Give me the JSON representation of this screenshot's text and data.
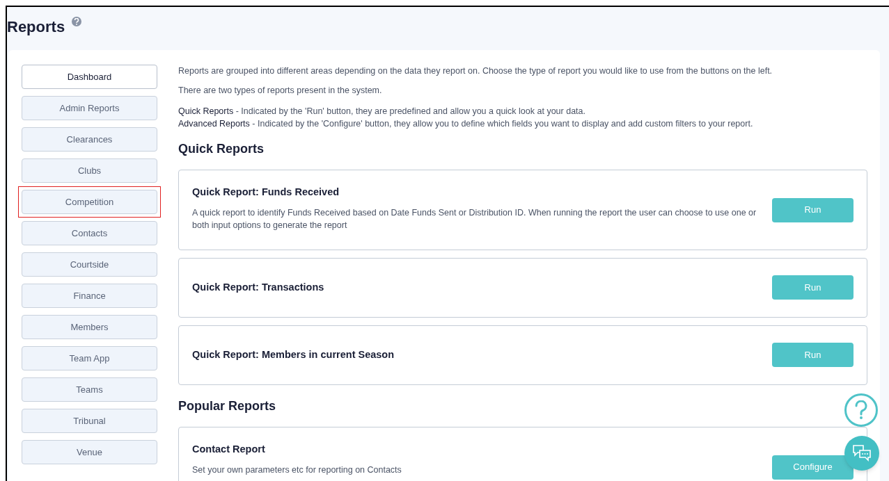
{
  "page_title": "Reports",
  "nav": [
    {
      "label": "Dashboard",
      "selected": true,
      "highlighted": false
    },
    {
      "label": "Admin Reports",
      "selected": false,
      "highlighted": false
    },
    {
      "label": "Clearances",
      "selected": false,
      "highlighted": false
    },
    {
      "label": "Clubs",
      "selected": false,
      "highlighted": false
    },
    {
      "label": "Competition",
      "selected": false,
      "highlighted": true
    },
    {
      "label": "Contacts",
      "selected": false,
      "highlighted": false
    },
    {
      "label": "Courtside",
      "selected": false,
      "highlighted": false
    },
    {
      "label": "Finance",
      "selected": false,
      "highlighted": false
    },
    {
      "label": "Members",
      "selected": false,
      "highlighted": false
    },
    {
      "label": "Team App",
      "selected": false,
      "highlighted": false
    },
    {
      "label": "Teams",
      "selected": false,
      "highlighted": false
    },
    {
      "label": "Tribunal",
      "selected": false,
      "highlighted": false
    },
    {
      "label": "Venue",
      "selected": false,
      "highlighted": false
    }
  ],
  "intro": [
    "Reports are grouped into different areas depending on the data they report on. Choose the type of report you would like to use from the buttons on the left.",
    "There are two types of reports present in the system."
  ],
  "legend": [
    "**Quick Reports** - Indicated by the 'Run' button, they are predefined and allow you a quick look at your data.",
    "**Advanced Reports** - Indicated by the 'Configure' button, they allow you to define which fields you want to display and add custom filters to your report."
  ],
  "sections": [
    {
      "title": "Quick Reports",
      "cards": [
        {
          "title": "Quick Report: Funds Received",
          "description": "A quick report to identify Funds Received based on Date Funds Sent or Distribution ID. When running the report the user can choose to use one or both input options to generate the report",
          "button": "Run"
        },
        {
          "title": "Quick Report: Transactions",
          "button": "Run"
        },
        {
          "title": "Quick Report: Members in current Season",
          "button": "Run"
        }
      ]
    },
    {
      "title": "Popular Reports",
      "cards": [
        {
          "title": "Contact Report",
          "description": "Set your own parameters etc for reporting on Contacts",
          "button": "Configure"
        }
      ]
    }
  ]
}
